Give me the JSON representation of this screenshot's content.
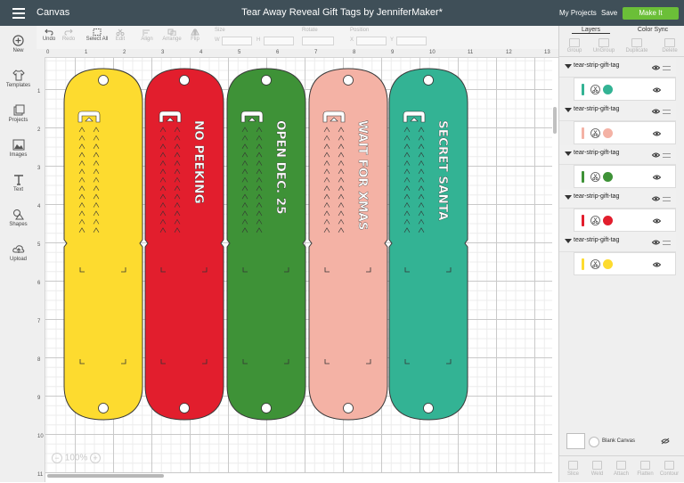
{
  "topbar": {
    "app_title": "Canvas",
    "document_title": "Tear Away Reveal Gift Tags by JenniferMaker*",
    "my_projects": "My Projects",
    "save": "Save",
    "make_it": "Make It",
    "make_it_color": "#6bbf38"
  },
  "left_tools": [
    {
      "label": "New",
      "icon": "plus-circle-icon"
    },
    {
      "label": "Templates",
      "icon": "shirt-icon"
    },
    {
      "label": "Projects",
      "icon": "projects-icon"
    },
    {
      "label": "Images",
      "icon": "image-icon"
    },
    {
      "label": "Text",
      "icon": "text-t-icon"
    },
    {
      "label": "Shapes",
      "icon": "shapes-icon"
    },
    {
      "label": "Upload",
      "icon": "upload-cloud-icon"
    }
  ],
  "toolbar": {
    "undo": "Undo",
    "redo": "Redo",
    "select_all": "Select All",
    "edit": "Edit",
    "align": "Align",
    "arrange": "Arrange",
    "flip": "Flip",
    "size_label": "Size",
    "w": "W",
    "h": "H",
    "rotate_label": "Rotate",
    "position_label": "Position",
    "x": "X",
    "y": "Y"
  },
  "ruler": {
    "top": [
      "0",
      "1",
      "2",
      "3",
      "4",
      "5",
      "6",
      "7",
      "8",
      "9",
      "10",
      "11",
      "12",
      "13"
    ],
    "left": [
      "1",
      "2",
      "3",
      "4",
      "5",
      "6",
      "7",
      "8",
      "9",
      "10",
      "11"
    ]
  },
  "zoom": {
    "minus": "−",
    "value": "100%",
    "plus": "+"
  },
  "tags": [
    {
      "color": "#fddb2f",
      "text": ""
    },
    {
      "color": "#e21e2d",
      "text": "NO PEEKING"
    },
    {
      "color": "#3e9237",
      "text": "OPEN DEC. 25"
    },
    {
      "color": "#f4b2a5",
      "text": "WAIT FOR XMAS"
    },
    {
      "color": "#33b394",
      "text": "SECRET SANTA"
    }
  ],
  "panel": {
    "tabs": [
      "Layers",
      "Color Sync"
    ],
    "actions": [
      "Group",
      "UnGroup",
      "Duplicate",
      "Delete"
    ],
    "layers": [
      {
        "name": "tear-strip-gift-tag",
        "color": "#33b394"
      },
      {
        "name": "tear-strip-gift-tag",
        "color": "#f4b2a5"
      },
      {
        "name": "tear-strip-gift-tag",
        "color": "#3e9237"
      },
      {
        "name": "tear-strip-gift-tag",
        "color": "#e21e2d"
      },
      {
        "name": "tear-strip-gift-tag",
        "color": "#fddb2f"
      }
    ],
    "blank_canvas": "Blank Canvas",
    "footer": [
      "Slice",
      "Weld",
      "Attach",
      "Flatten",
      "Contour"
    ]
  }
}
